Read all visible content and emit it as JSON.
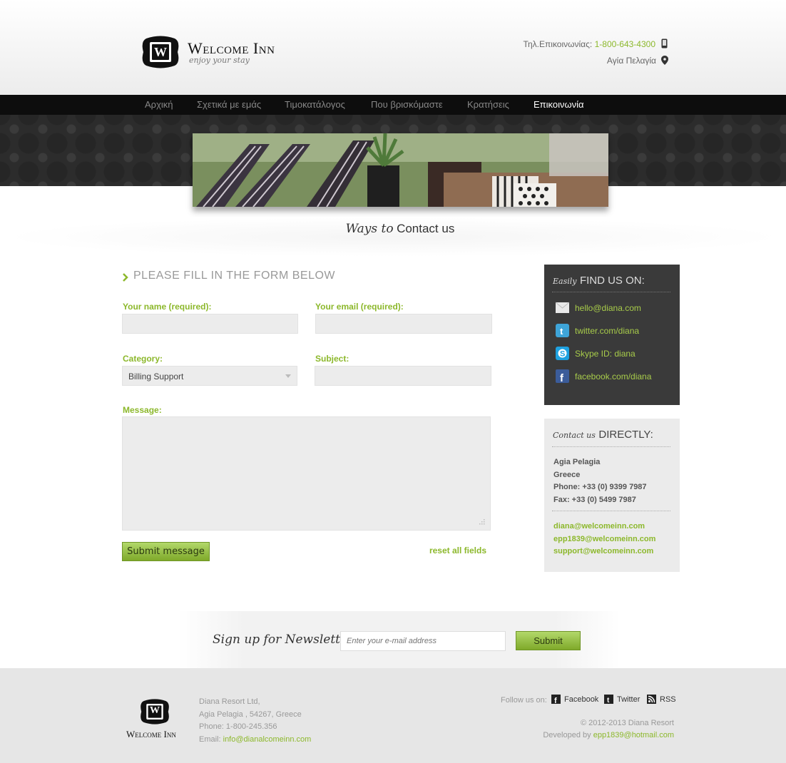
{
  "header": {
    "logo_letter": "W",
    "logo_title": "Welcome Inn",
    "logo_tagline": "enjoy your stay",
    "phone_label": "Τηλ.Επικοινωνίας:",
    "phone_number": "1-800-643-4300",
    "location": "Αγία Πελαγία"
  },
  "nav": {
    "items": [
      {
        "label": "Αρχική"
      },
      {
        "label": "Σχετικά με εμάς"
      },
      {
        "label": "Τιμοκατάλογος"
      },
      {
        "label": "Που βρισκόμαστε"
      },
      {
        "label": "Κρατήσεις"
      },
      {
        "label": "Επικοινωνία"
      }
    ],
    "active": "Επικοινωνία"
  },
  "page": {
    "heading_script": "Ways to",
    "heading_main": "Contact us"
  },
  "form": {
    "title": "PLEASE FILL IN THE FORM BELOW",
    "name_label": "Your name (required):",
    "name_value": "",
    "email_label": "Your email (required):",
    "email_value": "",
    "category_label": "Category:",
    "category_value": "Billing Support",
    "subject_label": "Subject:",
    "subject_value": "",
    "message_label": "Message:",
    "message_value": "",
    "submit_label": "Submit message",
    "reset_label": "reset all fields"
  },
  "find_us": {
    "title_script": "Easily",
    "title_main": "FIND US ON:",
    "items": [
      {
        "icon": "email-icon",
        "label": "hello@diana.com"
      },
      {
        "icon": "twitter-icon",
        "label": "twitter.com/diana"
      },
      {
        "icon": "skype-icon",
        "label": "Skype ID: diana"
      },
      {
        "icon": "facebook-icon",
        "label": "facebook.com/diana"
      }
    ]
  },
  "contact_direct": {
    "title_script": "Contact us",
    "title_main": "DIRECTLY:",
    "address_lines": [
      "Agia Pelagia",
      "Greece",
      "Phone: +33 (0) 9399 7987",
      "Fax: +33 (0) 5499 7987"
    ],
    "emails": [
      "diana@welcomeinn.com",
      "epp1839@welcomeinn.com",
      "support@welcomeinn.com"
    ]
  },
  "newsletter": {
    "title": "Sign up for Newsletter:",
    "placeholder": "Enter your e-mail address",
    "submit_label": "Submit"
  },
  "footer": {
    "company_lines": [
      "Diana Resort Ltd,",
      "Agia Pelagia , 54267, Greece",
      "Phone: 1-800-245.356"
    ],
    "email_label": "Email:",
    "email_value": "info@dianalcomeinn.com",
    "follow_label": "Follow us on:",
    "social": [
      {
        "icon": "facebook-icon",
        "label": "Facebook"
      },
      {
        "icon": "twitter-icon",
        "label": "Twitter"
      },
      {
        "icon": "rss-icon",
        "label": "RSS"
      }
    ],
    "copyright": "© 2012-2013 Diana Resort",
    "developed_label": "Developed by",
    "developed_email": "epp1839@hotmail.com",
    "logo_letter": "W",
    "logo_title": "Welcome Inn"
  },
  "colors": {
    "accent": "#8cb82b",
    "dark_panel": "#3a3a3a",
    "nav_bg": "#0d0d0d",
    "footer_bg": "#e6e6e6"
  }
}
